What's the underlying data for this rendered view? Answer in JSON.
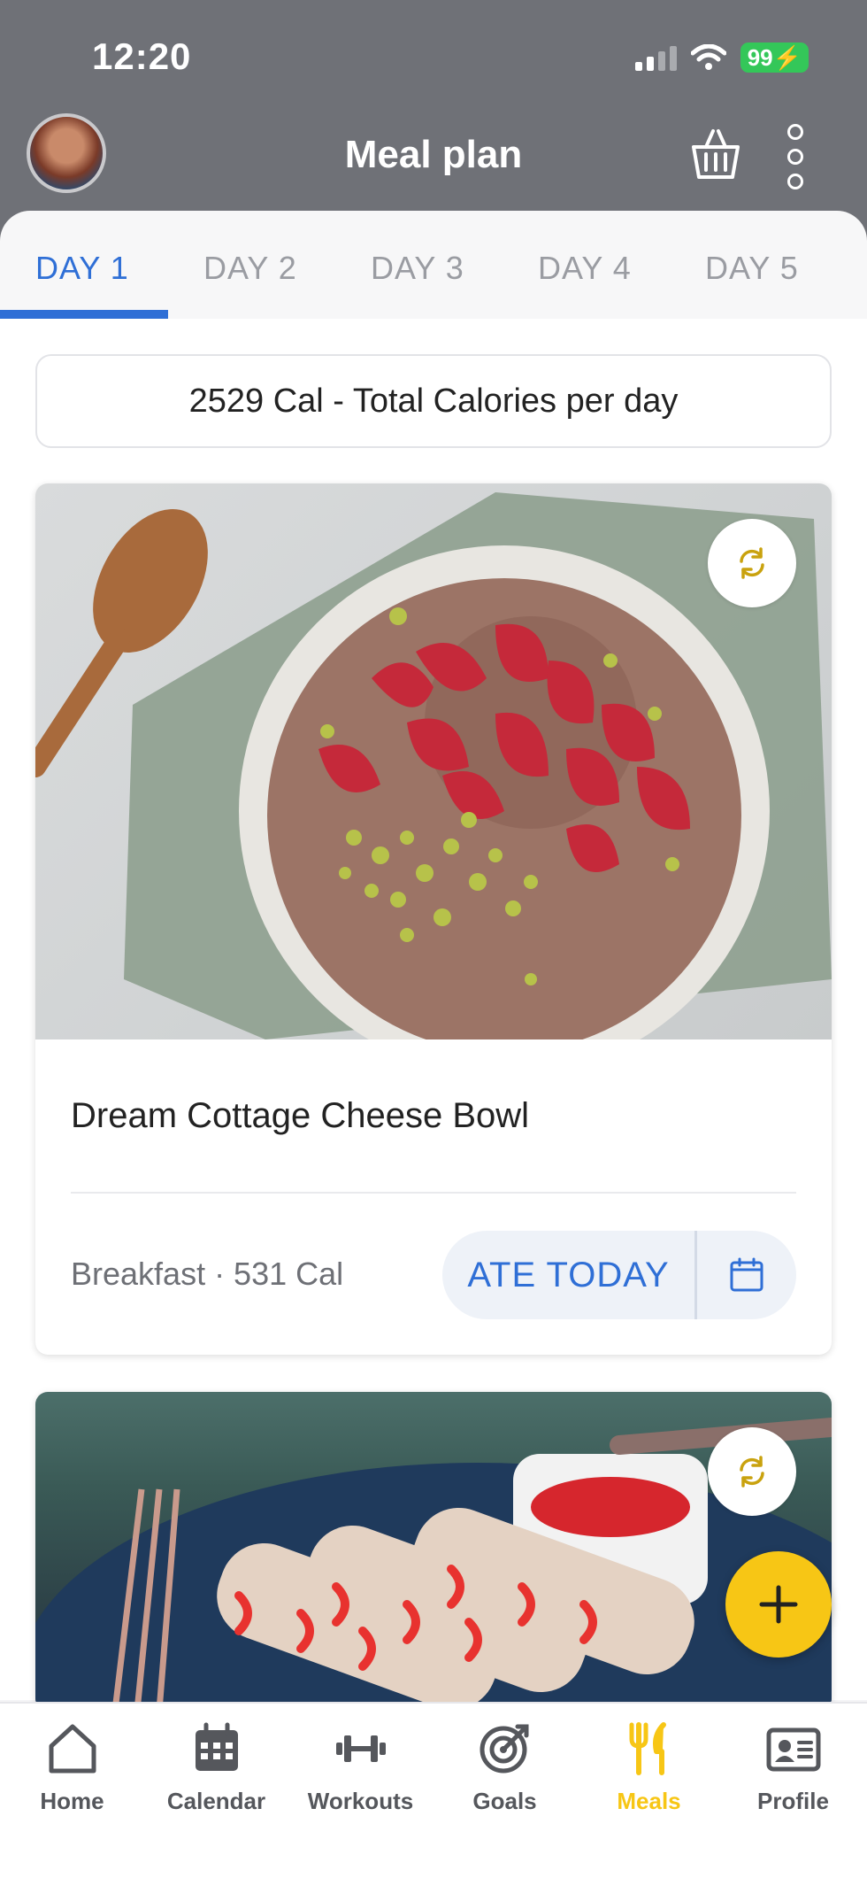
{
  "status": {
    "time": "12:20",
    "battery": "99"
  },
  "header": {
    "title": "Meal plan",
    "avatar_icon": "avatar",
    "basket_icon": "basket-icon",
    "menu_icon": "more-vertical-icon"
  },
  "tabs": [
    {
      "label": "DAY 1",
      "active": true
    },
    {
      "label": "DAY 2"
    },
    {
      "label": "DAY 3"
    },
    {
      "label": "DAY 4"
    },
    {
      "label": "DAY 5"
    }
  ],
  "summary": {
    "calories_text": "2529 Cal - Total Calories per day"
  },
  "meals": [
    {
      "name": "Dream Cottage Cheese Bowl",
      "meta": "Breakfast · 531 Cal",
      "ate_label": "ATE TODAY"
    },
    {
      "name": "",
      "meta": ""
    }
  ],
  "fab": {
    "icon": "plus-icon"
  },
  "bottom_nav": [
    {
      "label": "Home",
      "icon": "home-icon"
    },
    {
      "label": "Calendar",
      "icon": "calendar-icon"
    },
    {
      "label": "Workouts",
      "icon": "dumbbell-icon"
    },
    {
      "label": "Goals",
      "icon": "target-icon"
    },
    {
      "label": "Meals",
      "icon": "fork-knife-icon",
      "active": true
    },
    {
      "label": "Profile",
      "icon": "id-card-icon"
    }
  ],
  "colors": {
    "accent_blue": "#2f6fd6",
    "accent_yellow": "#f7c615",
    "header_gray": "#6f7177"
  }
}
